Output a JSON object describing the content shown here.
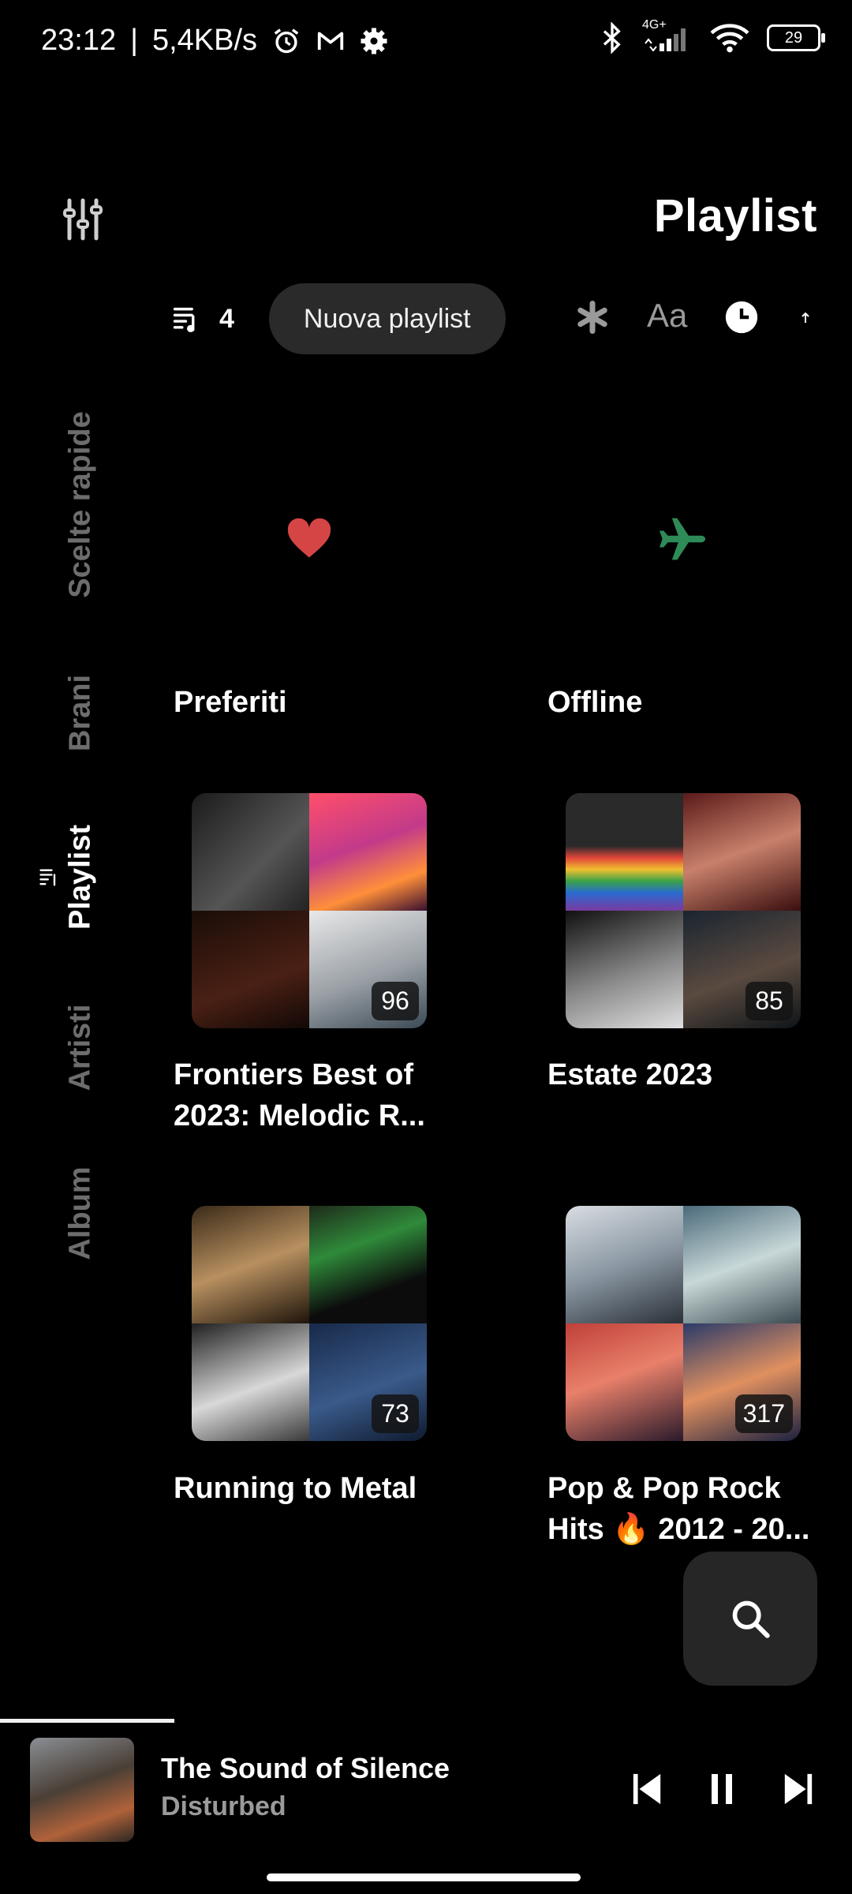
{
  "status_bar": {
    "time": "23:12",
    "separator": "|",
    "speed": "5,4KB/s",
    "network": "4G+",
    "battery": "29"
  },
  "header": {
    "title": "Playlist"
  },
  "toolbar": {
    "count": "4",
    "new_playlist_label": "Nuova playlist",
    "font_label": "Aa"
  },
  "side_tabs": [
    {
      "label": "Scelte rapide",
      "active": false
    },
    {
      "label": "Brani",
      "active": false
    },
    {
      "label": "Playlist",
      "active": true
    },
    {
      "label": "Artisti",
      "active": false
    },
    {
      "label": "Album",
      "active": false
    }
  ],
  "quick_items": [
    {
      "label": "Preferiti",
      "icon": "heart-icon",
      "color": "#d64545"
    },
    {
      "label": "Offline",
      "icon": "airplane-icon",
      "color": "#2e8b57"
    }
  ],
  "playlists": [
    {
      "title_line1": "Frontiers Best of",
      "title_line2": "2023: Melodic R...",
      "count": "96"
    },
    {
      "title_line1": "Estate 2023",
      "title_line2": "",
      "count": "85"
    },
    {
      "title_line1": "Running to Metal",
      "title_line2": "",
      "count": "73"
    },
    {
      "title_line1": "Pop & Pop Rock",
      "title_line2": "Hits 🔥 2012 - 20...",
      "count": "317"
    }
  ],
  "player": {
    "title": "The Sound of Silence",
    "artist": "Disturbed",
    "progress": 0.205
  },
  "colors": {
    "background": "#000000",
    "pill": "#2a2a2a",
    "inactive_tab": "#6d6d6d",
    "heart": "#d64545",
    "airplane": "#2e8b57"
  }
}
